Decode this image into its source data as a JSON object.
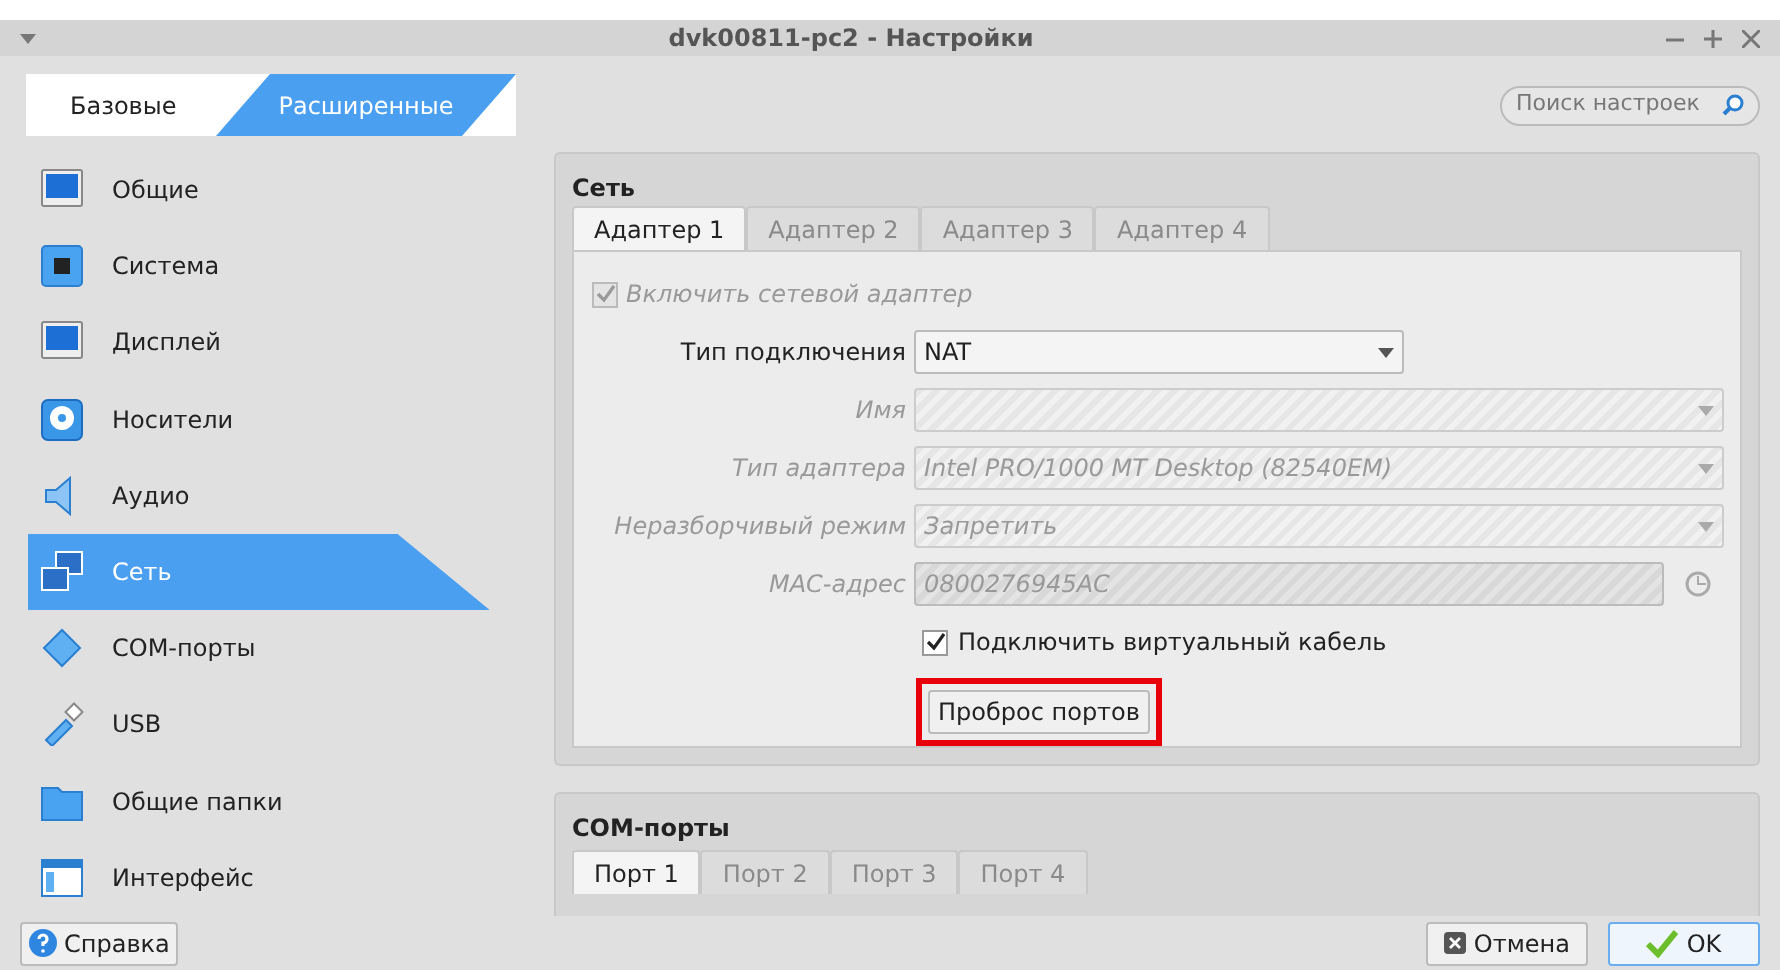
{
  "window": {
    "title": "dvk00811-pc2 - Настройки"
  },
  "mode_tabs": [
    {
      "label": "Базовые",
      "selected": false
    },
    {
      "label": "Расширенные",
      "selected": true
    }
  ],
  "search": {
    "placeholder": "Поиск настроек"
  },
  "sidebar": {
    "items": [
      {
        "label": "Общие",
        "kind": "general",
        "selected": false
      },
      {
        "label": "Система",
        "kind": "system",
        "selected": false
      },
      {
        "label": "Дисплей",
        "kind": "display",
        "selected": false
      },
      {
        "label": "Носители",
        "kind": "storage",
        "selected": false
      },
      {
        "label": "Аудио",
        "kind": "audio",
        "selected": false
      },
      {
        "label": "Сеть",
        "kind": "network",
        "selected": true
      },
      {
        "label": "COM-порты",
        "kind": "serial",
        "selected": false
      },
      {
        "label": "USB",
        "kind": "usb",
        "selected": false
      },
      {
        "label": "Общие папки",
        "kind": "folder",
        "selected": false
      },
      {
        "label": "Интерфейс",
        "kind": "ui",
        "selected": false
      }
    ]
  },
  "network": {
    "title": "Сеть",
    "tabs": [
      {
        "label": "Адаптер 1",
        "selected": true
      },
      {
        "label": "Адаптер 2",
        "selected": false
      },
      {
        "label": "Адаптер 3",
        "selected": false
      },
      {
        "label": "Адаптер 4",
        "selected": false
      }
    ],
    "enable_adapter": {
      "label": "Включить сетевой адаптер",
      "checked": true,
      "disabled": true
    },
    "fields": [
      {
        "label": "Тип подключения",
        "value": "NAT",
        "kind": "select",
        "disabled": false
      },
      {
        "label": "Имя",
        "kind": "select",
        "disabled": true
      },
      {
        "label": "Тип адаптера",
        "value": "Intel PRO/1000 MT Desktop (82540EM)",
        "kind": "select",
        "disabled": true
      },
      {
        "label": "Неразборчивый режим",
        "value": "Запретить",
        "kind": "select",
        "disabled": true
      },
      {
        "label": "MAC-адрес",
        "value": "0800276945AC",
        "kind": "text",
        "disabled": true
      }
    ],
    "cable": {
      "label": "Подключить виртуальный кабель",
      "checked": true,
      "disabled": false
    },
    "port_forwarding": {
      "label": "Проброс портов",
      "highlighted": true
    }
  },
  "com_ports": {
    "title": "COM-порты",
    "tabs": [
      {
        "label": "Порт 1",
        "selected": true
      },
      {
        "label": "Порт 2",
        "selected": false
      },
      {
        "label": "Порт 3",
        "selected": false
      },
      {
        "label": "Порт 4",
        "selected": false
      }
    ]
  },
  "buttons": {
    "help": "Справка",
    "cancel": "Отмена",
    "ok": "OK"
  }
}
